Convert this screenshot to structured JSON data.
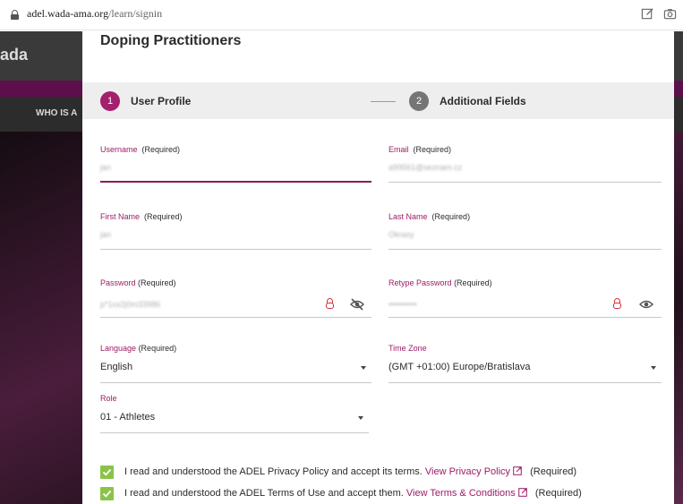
{
  "browser": {
    "url_host": "adel.wada-ama.org",
    "url_path": "/learn/signin"
  },
  "background": {
    "logo_text": "ada",
    "nav_text": "WHO IS A"
  },
  "modal": {
    "title": "Doping Practitioners",
    "steps": [
      {
        "number": "1",
        "label": "User Profile"
      },
      {
        "number": "2",
        "label": "Additional Fields"
      }
    ],
    "fields": {
      "username": {
        "label": "Username",
        "req": "(Required)",
        "value": "jan"
      },
      "email": {
        "label": "Email",
        "req": "(Required)",
        "value": "a99561@seznam.cz"
      },
      "first_name": {
        "label": "First Name",
        "req": "(Required)",
        "value": "jan"
      },
      "last_name": {
        "label": "Last Name",
        "req": "(Required)",
        "value": "Okrasy"
      },
      "password": {
        "label": "Password",
        "req": "(Required)",
        "value": "p*1xx2j0m33986"
      },
      "retype_password": {
        "label": "Retype Password",
        "req": "(Required)",
        "value": "••••••••••"
      }
    },
    "selects": {
      "language": {
        "label": "Language",
        "req": "(Required)",
        "value": "English"
      },
      "timezone": {
        "label": "Time Zone",
        "value": "(GMT +01:00) Europe/Bratislava"
      },
      "role": {
        "label": "Role",
        "value": "01 - Athletes"
      }
    },
    "consents": [
      {
        "text": "I read and understood the ADEL Privacy Policy and accept its terms.",
        "link": "View Privacy Policy",
        "req": "(Required)",
        "checked": true
      },
      {
        "text": "I read and understood the ADEL Terms of Use and accept them.",
        "link": "View Terms & Conditions",
        "req": "(Required)",
        "checked": true
      }
    ]
  },
  "colors": {
    "accent": "#9c1c66",
    "step_active": "#a4206d",
    "step_inactive": "#757575",
    "checkbox": "#8bc34a",
    "lock_red": "#d0303a"
  },
  "icons": [
    "lock-icon",
    "edit-icon",
    "camera-icon",
    "padlock-icon",
    "eye-off-icon",
    "eye-icon",
    "checkmark-icon",
    "external-link-icon",
    "dropdown-caret-icon"
  ]
}
